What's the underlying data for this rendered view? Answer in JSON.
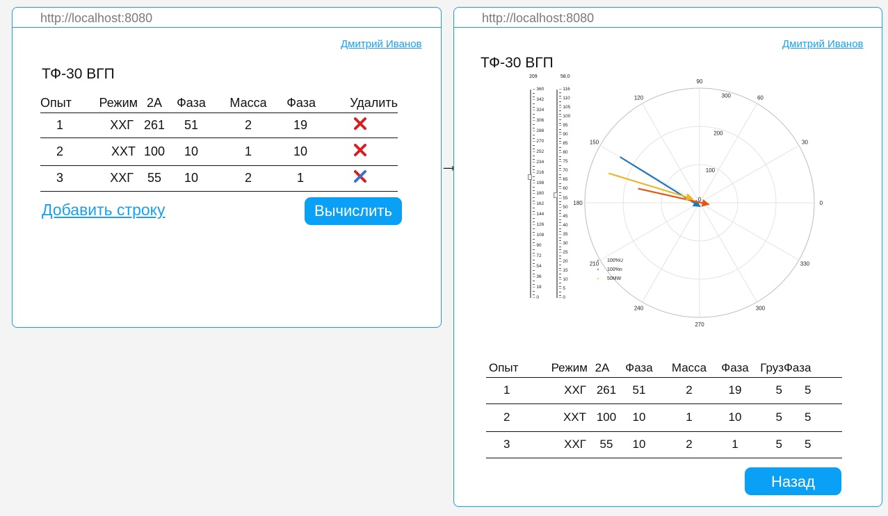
{
  "transition_arrow": "→",
  "left_window": {
    "url": "http://localhost:8080",
    "user": "Дмитрий Иванов",
    "title": "ТФ-30 ВГП",
    "headers": [
      "Опыт",
      "Режим",
      "2А",
      "Фаза",
      "Масса",
      "Фаза",
      "Удалить"
    ],
    "rows": [
      [
        "1",
        "ХХГ",
        "261",
        "51",
        "2",
        "19"
      ],
      [
        "2",
        "ХХТ",
        "100",
        "10",
        "1",
        "10"
      ],
      [
        "3",
        "ХХГ",
        "55",
        "10",
        "2",
        "1"
      ]
    ],
    "add_row_label": "Добавить строку",
    "compute_label": "Вычислить",
    "delete_icon": "delete-x-icon"
  },
  "right_window": {
    "url": "http://localhost:8080",
    "user": "Дмитрий Иванов",
    "title": "ТФ-30 ВГП",
    "slider1": {
      "max_label": "209",
      "ticks": [
        "360",
        "342",
        "324",
        "306",
        "288",
        "270",
        "252",
        "234",
        "216",
        "198",
        "180",
        "162",
        "144",
        "126",
        "108",
        "90",
        "72",
        "54",
        "36",
        "18",
        "0"
      ]
    },
    "slider2": {
      "max_label": "58.0",
      "ticks": [
        "116",
        "110",
        "105",
        "100",
        "95",
        "90",
        "85",
        "80",
        "75",
        "70",
        "65",
        "60",
        "55",
        "50",
        "45",
        "40",
        "35",
        "30",
        "25",
        "20",
        "15",
        "10",
        "5",
        "0"
      ]
    },
    "polar_chart": {
      "angle_labels": [
        "90",
        "60",
        "30",
        "0",
        "330",
        "300",
        "270",
        "240",
        "210",
        "180",
        "150",
        "120"
      ],
      "radial_labels": [
        "100",
        "200",
        "300"
      ],
      "center_label": "0",
      "legend": [
        {
          "label": "100%U",
          "color": "#1f77b4"
        },
        {
          "label": "100%n",
          "color": "#e6550d"
        },
        {
          "label": "50MW",
          "color": "#f0b429"
        }
      ]
    },
    "chart_data": {
      "type": "polar",
      "r_max": 300,
      "radial_ticks": [
        100,
        200,
        300
      ],
      "angle_ticks_deg": [
        0,
        30,
        60,
        90,
        120,
        150,
        180,
        210,
        240,
        270,
        300,
        330
      ],
      "series": [
        {
          "name": "100%U",
          "color": "#1f77b4",
          "vector": {
            "from_r": 240,
            "from_theta_deg": 150,
            "to_r": 10,
            "to_theta_deg": 280
          }
        },
        {
          "name": "100%n",
          "color": "#e6550d",
          "vector": {
            "from_r": 165,
            "from_theta_deg": 167,
            "to_r": 25,
            "to_theta_deg": 350
          }
        },
        {
          "name": "50MW",
          "color": "#f0b429",
          "vector": {
            "from_r": 250,
            "from_theta_deg": 162,
            "to_r": 20,
            "to_theta_deg": 150
          }
        }
      ]
    },
    "headers": [
      "Опыт",
      "Режим",
      "2А",
      "Фаза",
      "Масса",
      "Фаза",
      "Груз",
      "Фаза"
    ],
    "rows": [
      [
        "1",
        "ХХГ",
        "261",
        "51",
        "2",
        "19",
        "5",
        "5"
      ],
      [
        "2",
        "ХХТ",
        "100",
        "10",
        "1",
        "10",
        "5",
        "5"
      ],
      [
        "3",
        "ХХГ",
        "55",
        "10",
        "2",
        "1",
        "5",
        "5"
      ]
    ],
    "back_label": "Назад"
  }
}
